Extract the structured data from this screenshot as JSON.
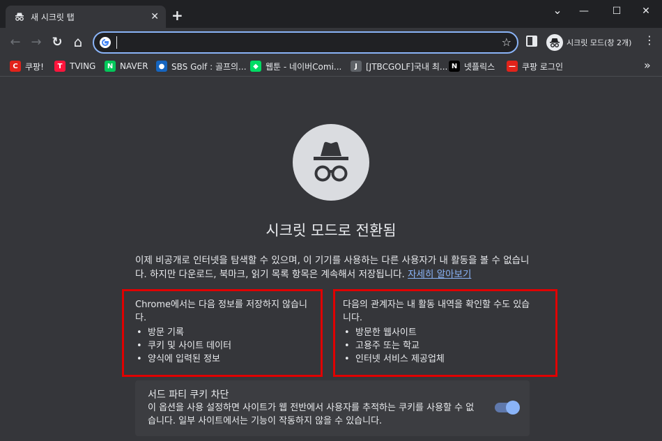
{
  "tab": {
    "title": "새 시크릿 탭",
    "close": "✕"
  },
  "new_tab": "+",
  "window": {
    "minimize": "—",
    "maximize": "☐",
    "close": "✕"
  },
  "chevron": "⌄",
  "toolbar": {
    "back": "←",
    "forward": "→",
    "reload": "↻",
    "home": "⌂",
    "omnibox_value": "",
    "star": "☆",
    "incognito_label": "시크릿 모드(창 2개)",
    "menu": "⋮"
  },
  "bookmarks": [
    {
      "label": "쿠팡!",
      "icon": "coupang-icon",
      "color": "#e2231a",
      "glyph": "C"
    },
    {
      "label": "TVING",
      "icon": "tving-icon",
      "color": "#ff153c",
      "glyph": "T"
    },
    {
      "label": "NAVER",
      "icon": "naver-icon",
      "color": "#03c75a",
      "glyph": "N"
    },
    {
      "label": "SBS Golf : 골프의...",
      "icon": "sbs-golf-icon",
      "color": "#1565c0",
      "glyph": "●"
    },
    {
      "label": "웹툰 - 네이버Comi...",
      "icon": "webtoon-icon",
      "color": "#00dc64",
      "glyph": "◆"
    },
    {
      "label": "[JTBCGOLF]국내 최...",
      "icon": "jtbc-golf-icon",
      "color": "#5f6368",
      "glyph": "J"
    },
    {
      "label": "넷플릭스",
      "icon": "netflix-icon",
      "color": "#000000",
      "glyph": "N"
    },
    {
      "label": "쿠팡 로그인",
      "icon": "coupang-login-icon",
      "color": "#e2231a",
      "glyph": "—"
    }
  ],
  "bookmarks_more": "»",
  "main": {
    "title": "시크릿 모드로 전환됨",
    "intro": "이제 비공개로 인터넷을 탐색할 수 있으며, 이 기기를 사용하는 다른 사용자가 내 활동을 볼 수 없습니다. 하지만 다운로드, 북마크, 읽기 목록 항목은 계속해서 저장됩니다.",
    "learn_more": "자세히 알아보기",
    "not_saved": {
      "heading": "Chrome에서는 다음 정보를 저장하지 않습니다.",
      "items": [
        "방문 기록",
        "쿠키 및 사이트 데이터",
        "양식에 입력된 정보"
      ]
    },
    "visible_to": {
      "heading": "다음의 관계자는 내 활동 내역을 확인할 수도 있습니다.",
      "items": [
        "방문한 웹사이트",
        "고용주 또는 학교",
        "인터넷 서비스 제공업체"
      ]
    },
    "third_party": {
      "title": "서드 파티 쿠키 차단",
      "description": "이 옵션을 사용 설정하면 사이트가 웹 전반에서 사용자를 추적하는 쿠키를 사용할 수 없습니다. 일부 사이트에서는 기능이 작동하지 않을 수 있습니다.",
      "enabled": true
    }
  },
  "colors": {
    "background": "#35363a",
    "frame": "#202124",
    "accent": "#8ab4f8",
    "highlight_box": "#e00000"
  }
}
